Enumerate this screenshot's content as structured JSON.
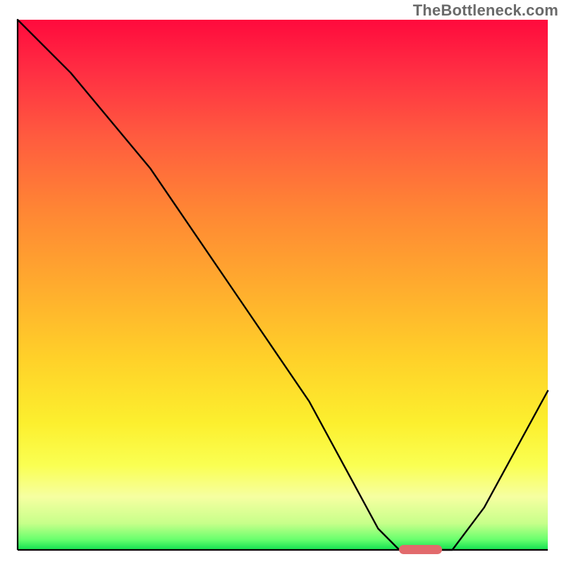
{
  "watermark": "TheBottleneck.com",
  "chart_data": {
    "type": "line",
    "title": "",
    "xlabel": "",
    "ylabel": "",
    "xlim": [
      0,
      100
    ],
    "ylim": [
      0,
      100
    ],
    "grid": false,
    "legend": false,
    "series": [
      {
        "name": "bottleneck-curve",
        "x": [
          0,
          10,
          25,
          40,
          55,
          68,
          72,
          78,
          82,
          88,
          100
        ],
        "y": [
          100,
          90,
          72,
          50,
          28,
          4,
          0,
          0,
          0,
          8,
          30
        ]
      }
    ],
    "marker": {
      "name": "optimum-range",
      "x_start": 72,
      "x_end": 80,
      "y": 0,
      "color": "#e26a6c"
    },
    "background_gradient": {
      "stops": [
        {
          "pos": 0.0,
          "color": "#ff0a3d"
        },
        {
          "pos": 0.5,
          "color": "#ffab2e"
        },
        {
          "pos": 0.84,
          "color": "#faff52"
        },
        {
          "pos": 1.0,
          "color": "#10e050"
        }
      ],
      "direction": "top-to-bottom"
    }
  }
}
